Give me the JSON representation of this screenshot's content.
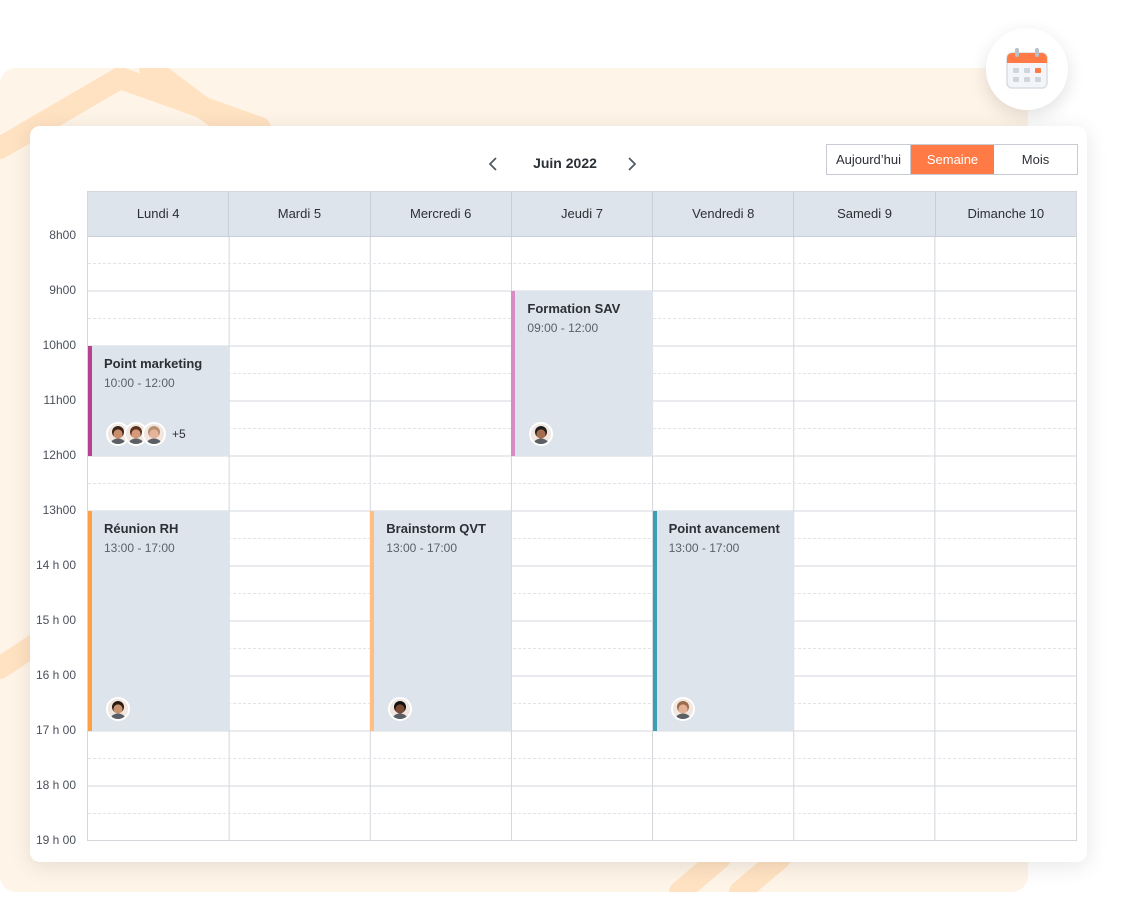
{
  "calendar": {
    "month_label": "Juin 2022",
    "views": {
      "today": "Aujourd’hui",
      "week": "Semaine",
      "month": "Mois",
      "active": "week"
    },
    "days": [
      "Lundi 4",
      "Mardi 5",
      "Mercredi 6",
      "Jeudi 7",
      "Vendredi 8",
      "Samedi 9",
      "Dimanche 10"
    ],
    "hours": [
      "8h00",
      "9h00",
      "10h00",
      "11h00",
      "12h00",
      "13h00",
      "14 h 00",
      "15 h 00",
      "16 h 00",
      "17 h 00",
      "18 h 00",
      "19 h 00"
    ],
    "events": [
      {
        "title": "Point marketing",
        "time": "10:00 - 12:00",
        "day": 0,
        "start": 10,
        "end": 12,
        "color": "#b5418f",
        "extra_participants": "+5"
      },
      {
        "title": "Formation SAV",
        "time": "09:00 - 12:00",
        "day": 3,
        "start": 9,
        "end": 12,
        "color": "#d98cc4"
      },
      {
        "title": "Réunion RH",
        "time": "13:00 - 17:00",
        "day": 0,
        "start": 13,
        "end": 17,
        "color": "#ff9f43"
      },
      {
        "title": "Brainstorm QVT",
        "time": "13:00 - 17:00",
        "day": 2,
        "start": 13,
        "end": 17,
        "color": "#ffbf80"
      },
      {
        "title": "Point avancement",
        "time": "13:00 - 17:00",
        "day": 4,
        "start": 13,
        "end": 17,
        "color": "#3a9fb0"
      }
    ]
  },
  "colors": {
    "accent": "#ff7a45",
    "header_bg": "#dde4ec",
    "event_bg": "#dde4ec",
    "background": "#fff4e8"
  },
  "icons": {
    "badge": "calendar-icon",
    "prev": "chevron-left-icon",
    "next": "chevron-right-icon",
    "participant": "avatar-icon"
  }
}
